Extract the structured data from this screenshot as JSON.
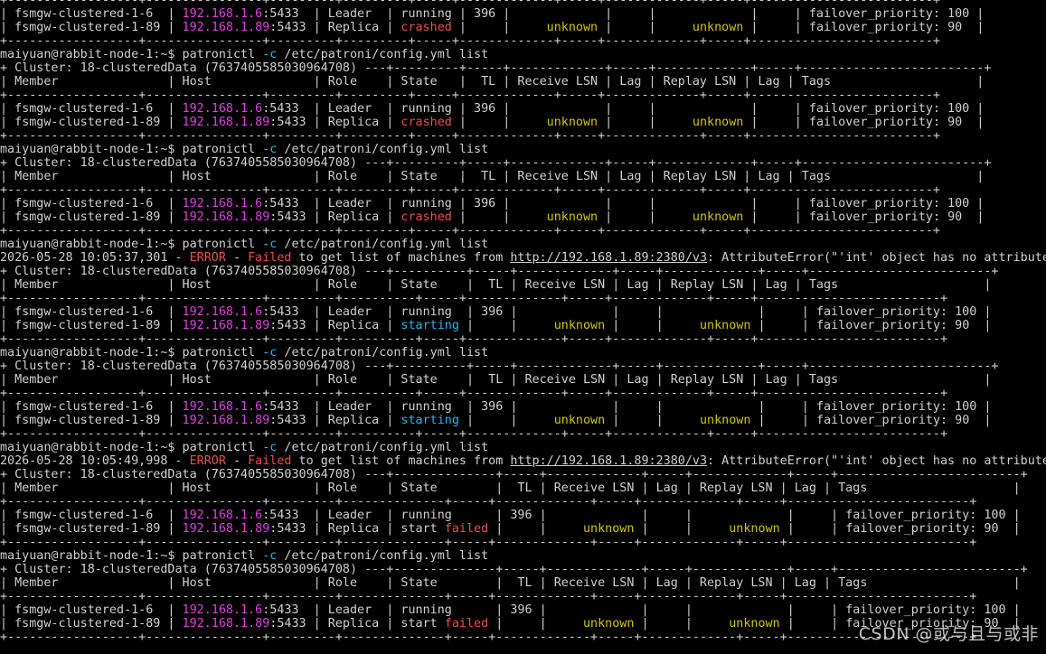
{
  "colors": {
    "background": "#000000",
    "text": "#d0d0d0",
    "ip": "#e040e0",
    "red": "#e8504a",
    "yellow": "#d2c400",
    "cyan": "#2ab6e6"
  },
  "watermark": "CSDN @或与且与或非",
  "lines": [
    {
      "segs": [
        {
          "t": "+------------------+----------------+---------+---------+-----+-------------+-----+-------------+-----+-------------------------+"
        }
      ]
    },
    {
      "segs": [
        {
          "t": "| fsmgw-clustered-1-6  | "
        },
        {
          "t": "192.168.1.6",
          "c": "ip"
        },
        {
          "t": ":5433  | Leader  | running | 396 |             |     |             |     | failover_priority: 100 |"
        }
      ]
    },
    {
      "segs": [
        {
          "t": "| fsmgw-clustered-1-89 | "
        },
        {
          "t": "192.168.1.89",
          "c": "ip"
        },
        {
          "t": ":5433 | Replica | "
        },
        {
          "t": "crashed",
          "c": "red"
        },
        {
          "t": " |     |     "
        },
        {
          "t": "unknown",
          "c": "yellow"
        },
        {
          "t": " |     |     "
        },
        {
          "t": "unknown",
          "c": "yellow"
        },
        {
          "t": " |     | failover_priority: 90  |"
        }
      ]
    },
    {
      "segs": [
        {
          "t": "+------------------+----------------+---------+---------+-----+-------------+-----+-------------+-----+-------------------------+"
        }
      ]
    },
    {
      "segs": [
        {
          "t": "maiyuan@rabbit-node-1:~$ patronictl "
        },
        {
          "t": "-c",
          "c": "cyan"
        },
        {
          "t": " /etc/patroni/config.yml list"
        }
      ]
    },
    {
      "segs": [
        {
          "t": "+ Cluster: 18-clusteredData (7637405585030964708) ---+---------+-----+-------------+-----+-------------+-----+-------------------------+"
        }
      ]
    },
    {
      "segs": [
        {
          "t": "| Member               | Host              | Role    | State   |  TL | Receive LSN | Lag | Replay LSN | Lag | Tags                    |"
        }
      ]
    },
    {
      "segs": [
        {
          "t": "+------------------+----------------+---------+---------+-----+-------------+-----+-------------+-----+-------------------------+"
        }
      ]
    },
    {
      "segs": [
        {
          "t": "| fsmgw-clustered-1-6  | "
        },
        {
          "t": "192.168.1.6",
          "c": "ip"
        },
        {
          "t": ":5433  | Leader  | running | 396 |             |     |             |     | failover_priority: 100 |"
        }
      ]
    },
    {
      "segs": [
        {
          "t": "| fsmgw-clustered-1-89 | "
        },
        {
          "t": "192.168.1.89",
          "c": "ip"
        },
        {
          "t": ":5433 | Replica | "
        },
        {
          "t": "crashed",
          "c": "red"
        },
        {
          "t": " |     |     "
        },
        {
          "t": "unknown",
          "c": "yellow"
        },
        {
          "t": " |     |     "
        },
        {
          "t": "unknown",
          "c": "yellow"
        },
        {
          "t": " |     | failover_priority: 90  |"
        }
      ]
    },
    {
      "segs": [
        {
          "t": "+------------------+----------------+---------+---------+-----+-------------+-----+-------------+-----+-------------------------+"
        }
      ]
    },
    {
      "segs": [
        {
          "t": "maiyuan@rabbit-node-1:~$ patronictl "
        },
        {
          "t": "-c",
          "c": "cyan"
        },
        {
          "t": " /etc/patroni/config.yml list"
        }
      ]
    },
    {
      "segs": [
        {
          "t": "+ Cluster: 18-clusteredData (7637405585030964708) ---+---------+-----+-------------+-----+-------------+-----+-------------------------+"
        }
      ]
    },
    {
      "segs": [
        {
          "t": "| Member               | Host              | Role    | State   |  TL | Receive LSN | Lag | Replay LSN | Lag | Tags                    |"
        }
      ]
    },
    {
      "segs": [
        {
          "t": "+------------------+----------------+---------+---------+-----+-------------+-----+-------------+-----+-------------------------+"
        }
      ]
    },
    {
      "segs": [
        {
          "t": "| fsmgw-clustered-1-6  | "
        },
        {
          "t": "192.168.1.6",
          "c": "ip"
        },
        {
          "t": ":5433  | Leader  | running | 396 |             |     |             |     | failover_priority: 100 |"
        }
      ]
    },
    {
      "segs": [
        {
          "t": "| fsmgw-clustered-1-89 | "
        },
        {
          "t": "192.168.1.89",
          "c": "ip"
        },
        {
          "t": ":5433 | Replica | "
        },
        {
          "t": "crashed",
          "c": "red"
        },
        {
          "t": " |     |     "
        },
        {
          "t": "unknown",
          "c": "yellow"
        },
        {
          "t": " |     |     "
        },
        {
          "t": "unknown",
          "c": "yellow"
        },
        {
          "t": " |     | failover_priority: 90  |"
        }
      ]
    },
    {
      "segs": [
        {
          "t": "+------------------+----------------+---------+---------+-----+-------------+-----+-------------+-----+-------------------------+"
        }
      ]
    },
    {
      "segs": [
        {
          "t": "maiyuan@rabbit-node-1:~$ patronictl "
        },
        {
          "t": "-c",
          "c": "cyan"
        },
        {
          "t": " /etc/patroni/config.yml list"
        }
      ]
    },
    {
      "segs": [
        {
          "t": "2026-05-28 10:05:37,301 - "
        },
        {
          "t": "ERROR",
          "c": "red"
        },
        {
          "t": " - "
        },
        {
          "t": "Failed",
          "c": "red"
        },
        {
          "t": " to get list of machines from "
        },
        {
          "t": "http://192.168.1.89:2380/v3",
          "c": "link"
        },
        {
          "t": ": AttributeError(\"'int' object has no attribute"
        }
      ]
    },
    {
      "segs": [
        {
          "t": "+ Cluster: 18-clusteredData (7637405585030964708) ---+----------+-----+-------------+-----+-------------+-----+-------------------------+"
        }
      ]
    },
    {
      "segs": [
        {
          "t": "| Member               | Host              | Role    | State    |  TL | Receive LSN | Lag | Replay LSN | Lag | Tags                    |"
        }
      ]
    },
    {
      "segs": [
        {
          "t": "+------------------+----------------+---------+----------+-----+-------------+-----+-------------+-----+-------------------------+"
        }
      ]
    },
    {
      "segs": [
        {
          "t": "| fsmgw-clustered-1-6  | "
        },
        {
          "t": "192.168.1.6",
          "c": "ip"
        },
        {
          "t": ":5433  | Leader  | running  | 396 |             |     |             |     | failover_priority: 100 |"
        }
      ]
    },
    {
      "segs": [
        {
          "t": "| fsmgw-clustered-1-89 | "
        },
        {
          "t": "192.168.1.89",
          "c": "ip"
        },
        {
          "t": ":5433 | Replica | "
        },
        {
          "t": "starting",
          "c": "cyan"
        },
        {
          "t": " |     |     "
        },
        {
          "t": "unknown",
          "c": "yellow"
        },
        {
          "t": " |     |     "
        },
        {
          "t": "unknown",
          "c": "yellow"
        },
        {
          "t": " |     | failover_priority: 90  |"
        }
      ]
    },
    {
      "segs": [
        {
          "t": "+------------------+----------------+---------+----------+-----+-------------+-----+-------------+-----+-------------------------+"
        }
      ]
    },
    {
      "segs": [
        {
          "t": "maiyuan@rabbit-node-1:~$ patronictl "
        },
        {
          "t": "-c",
          "c": "cyan"
        },
        {
          "t": " /etc/patroni/config.yml list"
        }
      ]
    },
    {
      "segs": [
        {
          "t": "+ Cluster: 18-clusteredData (7637405585030964708) ---+----------+-----+-------------+-----+-------------+-----+-------------------------+"
        }
      ]
    },
    {
      "segs": [
        {
          "t": "| Member               | Host              | Role    | State    |  TL | Receive LSN | Lag | Replay LSN | Lag | Tags                    |"
        }
      ]
    },
    {
      "segs": [
        {
          "t": "+------------------+----------------+---------+----------+-----+-------------+-----+-------------+-----+-------------------------+"
        }
      ]
    },
    {
      "segs": [
        {
          "t": "| fsmgw-clustered-1-6  | "
        },
        {
          "t": "192.168.1.6",
          "c": "ip"
        },
        {
          "t": ":5433  | Leader  | running  | 396 |             |     |             |     | failover_priority: 100 |"
        }
      ]
    },
    {
      "segs": [
        {
          "t": "| fsmgw-clustered-1-89 | "
        },
        {
          "t": "192.168.1.89",
          "c": "ip"
        },
        {
          "t": ":5433 | Replica | "
        },
        {
          "t": "starting",
          "c": "cyan"
        },
        {
          "t": " |     |     "
        },
        {
          "t": "unknown",
          "c": "yellow"
        },
        {
          "t": " |     |     "
        },
        {
          "t": "unknown",
          "c": "yellow"
        },
        {
          "t": " |     | failover_priority: 90  |"
        }
      ]
    },
    {
      "segs": [
        {
          "t": "+------------------+----------------+---------+----------+-----+-------------+-----+-------------+-----+-------------------------+"
        }
      ]
    },
    {
      "segs": [
        {
          "t": "maiyuan@rabbit-node-1:~$ patronictl "
        },
        {
          "t": "-c",
          "c": "cyan"
        },
        {
          "t": " /etc/patroni/config.yml list"
        }
      ]
    },
    {
      "segs": [
        {
          "t": "2026-05-28 10:05:49,998 - "
        },
        {
          "t": "ERROR",
          "c": "red"
        },
        {
          "t": " - "
        },
        {
          "t": "Failed",
          "c": "red"
        },
        {
          "t": " to get list of machines from "
        },
        {
          "t": "http://192.168.1.89:2380/v3",
          "c": "link"
        },
        {
          "t": ": AttributeError(\"'int' object has no attribute"
        }
      ]
    },
    {
      "segs": [
        {
          "t": "+ Cluster: 18-clusteredData (7637405585030964708) ---+--------------+-----+-------------+-----+-------------+-----+-------------------------+"
        }
      ]
    },
    {
      "segs": [
        {
          "t": "| Member               | Host              | Role    | State        |  TL | Receive LSN | Lag | Replay LSN | Lag | Tags                    |"
        }
      ]
    },
    {
      "segs": [
        {
          "t": "+------------------+----------------+---------+--------------+-----+-------------+-----+-------------+-----+-------------------------+"
        }
      ]
    },
    {
      "segs": [
        {
          "t": "| fsmgw-clustered-1-6  | "
        },
        {
          "t": "192.168.1.6",
          "c": "ip"
        },
        {
          "t": ":5433  | Leader  | running      | 396 |             |     |             |     | failover_priority: 100 |"
        }
      ]
    },
    {
      "segs": [
        {
          "t": "| fsmgw-clustered-1-89 | "
        },
        {
          "t": "192.168.1.89",
          "c": "ip"
        },
        {
          "t": ":5433 | Replica | start "
        },
        {
          "t": "failed",
          "c": "red"
        },
        {
          "t": " |     |     "
        },
        {
          "t": "unknown",
          "c": "yellow"
        },
        {
          "t": " |     |     "
        },
        {
          "t": "unknown",
          "c": "yellow"
        },
        {
          "t": " |     | failover_priority: 90  |"
        }
      ]
    },
    {
      "segs": [
        {
          "t": "+------------------+----------------+---------+--------------+-----+-------------+-----+-------------+-----+-------------------------+"
        }
      ]
    },
    {
      "segs": [
        {
          "t": "maiyuan@rabbit-node-1:~$ patronictl "
        },
        {
          "t": "-c",
          "c": "cyan"
        },
        {
          "t": " /etc/patroni/config.yml list"
        }
      ]
    },
    {
      "segs": [
        {
          "t": "+ Cluster: 18-clusteredData (7637405585030964708) ---+--------------+-----+-------------+-----+-------------+-----+-------------------------+"
        }
      ]
    },
    {
      "segs": [
        {
          "t": "| Member               | Host              | Role    | State        |  TL | Receive LSN | Lag | Replay LSN | Lag | Tags                    |"
        }
      ]
    },
    {
      "segs": [
        {
          "t": "+------------------+----------------+---------+--------------+-----+-------------+-----+-------------+-----+-------------------------+"
        }
      ]
    },
    {
      "segs": [
        {
          "t": "| fsmgw-clustered-1-6  | "
        },
        {
          "t": "192.168.1.6",
          "c": "ip"
        },
        {
          "t": ":5433  | Leader  | running      | 396 |             |     |             |     | failover_priority: 100 |"
        }
      ]
    },
    {
      "segs": [
        {
          "t": "| fsmgw-clustered-1-89 | "
        },
        {
          "t": "192.168.1.89",
          "c": "ip"
        },
        {
          "t": ":5433 | Replica | start "
        },
        {
          "t": "failed",
          "c": "red"
        },
        {
          "t": " |     |     "
        },
        {
          "t": "unknown",
          "c": "yellow"
        },
        {
          "t": " |     |     "
        },
        {
          "t": "unknown",
          "c": "yellow"
        },
        {
          "t": " |     | failover_priority: 90  |"
        }
      ]
    },
    {
      "segs": [
        {
          "t": "+------------------+----------------+---------+--------------+-----+-------------+-----+-------------+-----+-------------------------+"
        }
      ]
    }
  ]
}
